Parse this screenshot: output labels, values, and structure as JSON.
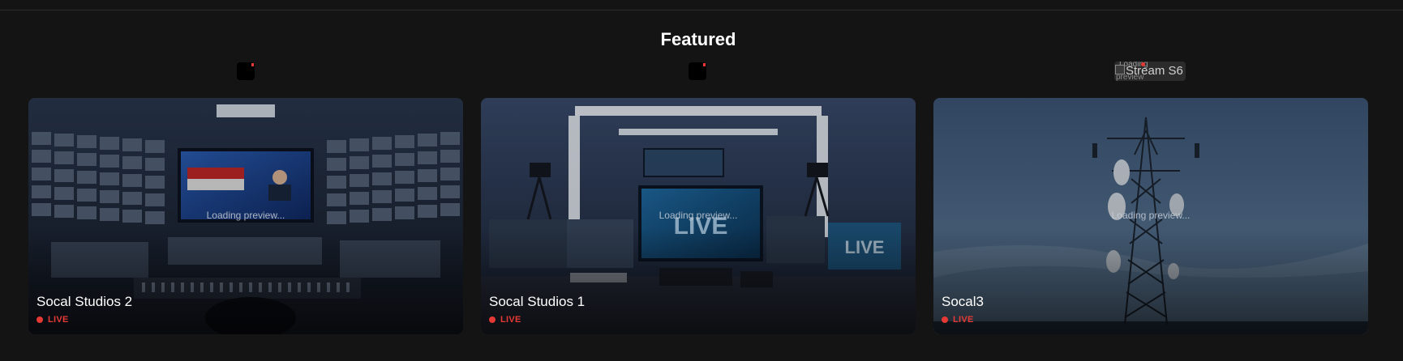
{
  "section": {
    "title": "Featured"
  },
  "top_previews": {
    "broken_alt": "Stream S6",
    "broken_ghost_1": "Loading",
    "broken_ghost_2": "preview"
  },
  "cards": [
    {
      "name": "Socal Studios 2",
      "status": "LIVE",
      "loading": "Loading preview...",
      "thumbnail": "broadcast-control-room"
    },
    {
      "name": "Socal Studios 1",
      "status": "LIVE",
      "loading": "Loading preview...",
      "thumbnail": "live-studio-set"
    },
    {
      "name": "Socal3",
      "status": "LIVE",
      "loading": "Loading preview...",
      "thumbnail": "cell-tower-sky"
    }
  ],
  "colors": {
    "background": "#141414",
    "live": "#e53935",
    "text": "#ffffff"
  }
}
